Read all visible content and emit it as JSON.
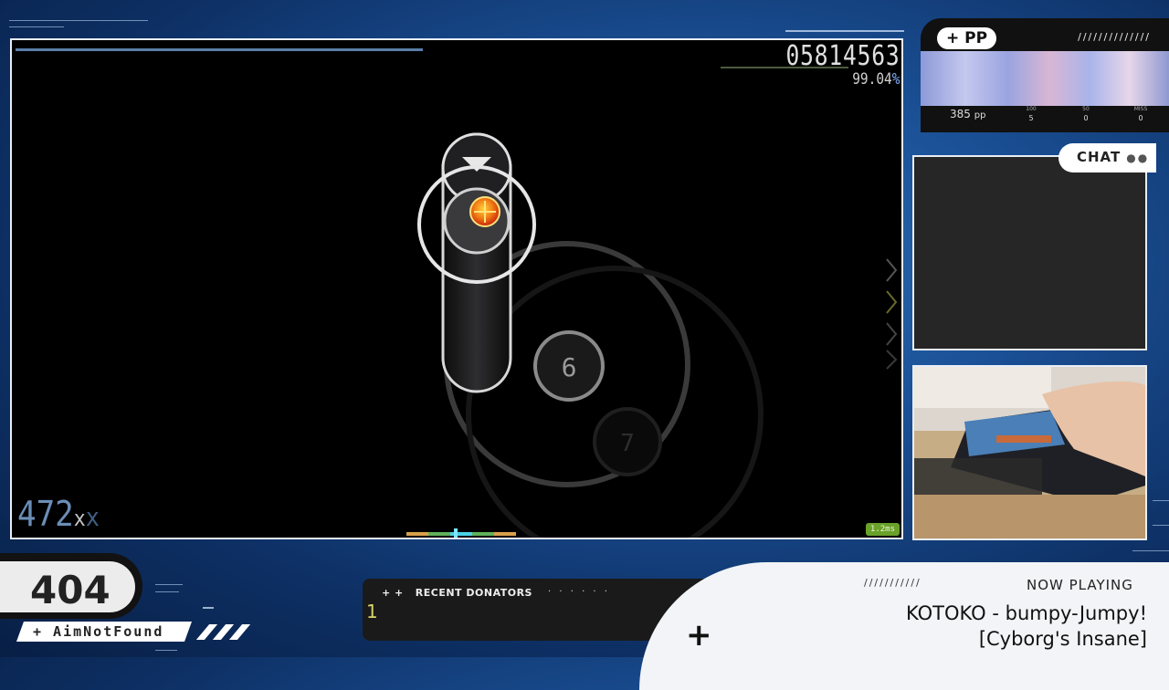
{
  "colors": {
    "background": "#1a4f94",
    "frame_border": "#e8eef6",
    "combo": "#7ea7d8",
    "latency_badge": "#6aa12a",
    "hit_object_center": "#e33a12"
  },
  "game": {
    "score": "05814563",
    "accuracy": "99.04",
    "accuracy_unit": "%",
    "combo": "472",
    "combo_suffix": "x",
    "combo_ghost_suffix": "x",
    "latency": "1.2ms",
    "hit_circle_number": "6",
    "approach_number": "7",
    "top_progress": 0.46
  },
  "pp_panel": {
    "badge": "+ PP",
    "slashes": "//////////////",
    "pp_value": "385",
    "pp_unit": "pp",
    "stats": [
      {
        "label": "100",
        "value": "5"
      },
      {
        "label": "50",
        "value": "0"
      },
      {
        "label": "MISS",
        "value": "0"
      }
    ]
  },
  "chat": {
    "label": "CHAT",
    "dots": "●●"
  },
  "player": {
    "rank": "404",
    "name": "+ AimNotFound"
  },
  "donators": {
    "prefix": "+ +",
    "title": "RECENT DONATORS",
    "dots": "· · · · · ·",
    "count": "1"
  },
  "now_playing": {
    "plus": "+",
    "slashes": "///////////",
    "label": "NOW PLAYING",
    "artist_title": "KOTOKO - bumpy-Jumpy!",
    "difficulty": "[Cyborg's Insane]"
  }
}
